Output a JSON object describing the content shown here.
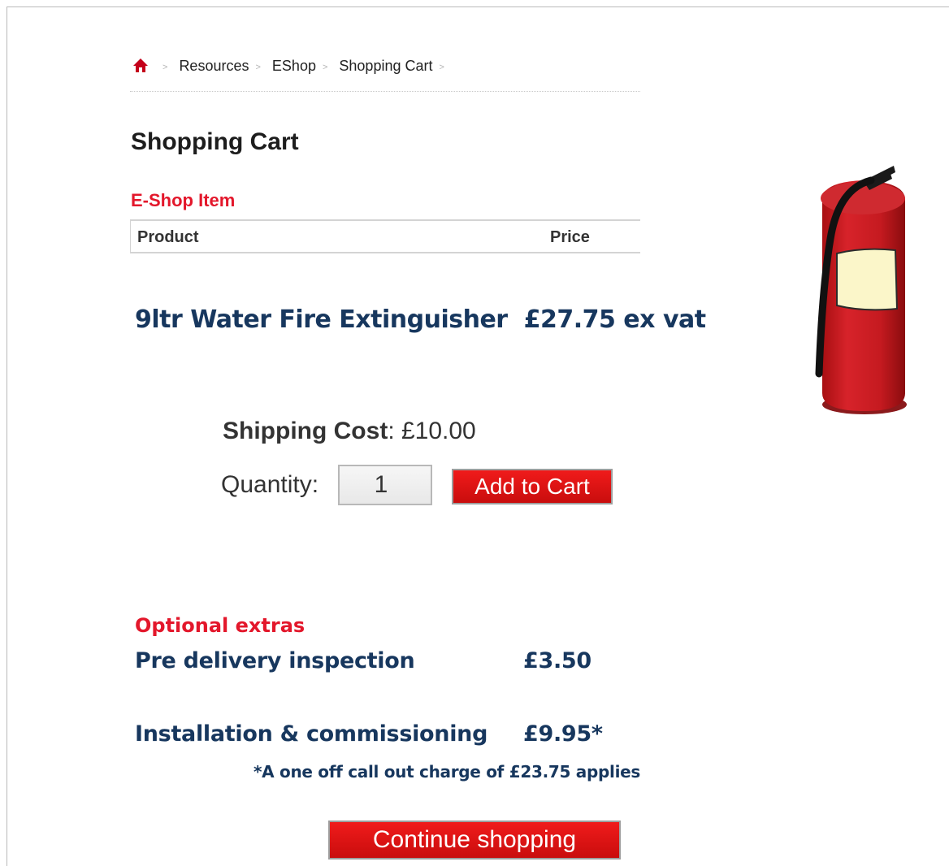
{
  "breadcrumb": {
    "home_icon": "home-icon",
    "separator": ">",
    "items": [
      "Resources",
      "EShop",
      "Shopping Cart"
    ]
  },
  "page": {
    "title": "Shopping Cart"
  },
  "cart": {
    "section_title": "E-Shop Item",
    "columns": {
      "product": "Product",
      "price": "Price"
    }
  },
  "product": {
    "name": "9ltr Water Fire Extinguisher",
    "price": "£27.75 ex vat",
    "image_icon": "fire-extinguisher-icon"
  },
  "shipping": {
    "label": "Shipping Cost",
    "value": ": £10.00"
  },
  "quantity": {
    "label": "Quantity:",
    "value": "1"
  },
  "buttons": {
    "add_to_cart": "Add to Cart",
    "continue_shopping": "Continue shopping"
  },
  "extras": {
    "title": "Optional extras",
    "items": [
      {
        "name": "Pre delivery inspection",
        "price": "£3.50"
      },
      {
        "name": "Installation & commissioning",
        "price": "£9.95*"
      }
    ],
    "footnote": "*A one off call out charge of £23.75 applies"
  },
  "colors": {
    "accent_red": "#e3172b",
    "navy_text": "#17375e",
    "button_red": "#e01010"
  }
}
